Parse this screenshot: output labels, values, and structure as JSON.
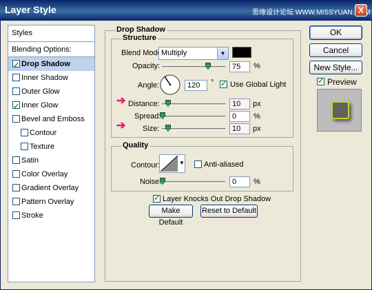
{
  "window": {
    "title": "Layer Style",
    "watermark": "思缘设计论坛 WWW.MISSYUAN.COM",
    "close_glyph": "X"
  },
  "left_panel": {
    "header": "Styles",
    "blending_label": "Blending Options: Default",
    "items": [
      {
        "label": "Drop Shadow",
        "checked": true,
        "selected": true
      },
      {
        "label": "Inner Shadow",
        "checked": false
      },
      {
        "label": "Outer Glow",
        "checked": false
      },
      {
        "label": "Inner Glow",
        "checked": true
      },
      {
        "label": "Bevel and Emboss",
        "checked": false
      },
      {
        "label": "Contour",
        "checked": false
      },
      {
        "label": "Texture",
        "checked": false
      },
      {
        "label": "Satin",
        "checked": false
      },
      {
        "label": "Color Overlay",
        "checked": false
      },
      {
        "label": "Gradient Overlay",
        "checked": false
      },
      {
        "label": "Pattern Overlay",
        "checked": false
      },
      {
        "label": "Stroke",
        "checked": false
      }
    ]
  },
  "drop_shadow": {
    "group_title": "Drop Shadow",
    "structure": {
      "title": "Structure",
      "blend_mode_label": "Blend Mode:",
      "blend_mode_value": "Multiply",
      "shadow_color": "#000000",
      "opacity_label": "Opacity:",
      "opacity_value": "75",
      "opacity_unit": "%",
      "angle_label": "Angle:",
      "angle_value": "120",
      "angle_unit": "°",
      "use_global_light_label": "Use Global Light",
      "use_global_light": true,
      "distance_label": "Distance:",
      "distance_value": "10",
      "distance_unit": "px",
      "spread_label": "Spread:",
      "spread_value": "0",
      "spread_unit": "%",
      "size_label": "Size:",
      "size_value": "10",
      "size_unit": "px"
    },
    "quality": {
      "title": "Quality",
      "contour_label": "Contour:",
      "anti_aliased_label": "Anti-aliased",
      "anti_aliased": false,
      "noise_label": "Noise:",
      "noise_value": "0",
      "noise_unit": "%"
    },
    "layer_knocks_out_label": "Layer Knocks Out Drop Shadow",
    "layer_knocks_out": true,
    "make_default_label": "Make Default",
    "reset_default_label": "Reset to Default"
  },
  "side_buttons": {
    "ok_label": "OK",
    "cancel_label": "Cancel",
    "new_style_label": "New Style...",
    "preview_label": "Preview",
    "preview_checked": true
  },
  "colors": {
    "accent_arrow": "#e8177a",
    "preview_glow": "#c9d61e"
  }
}
